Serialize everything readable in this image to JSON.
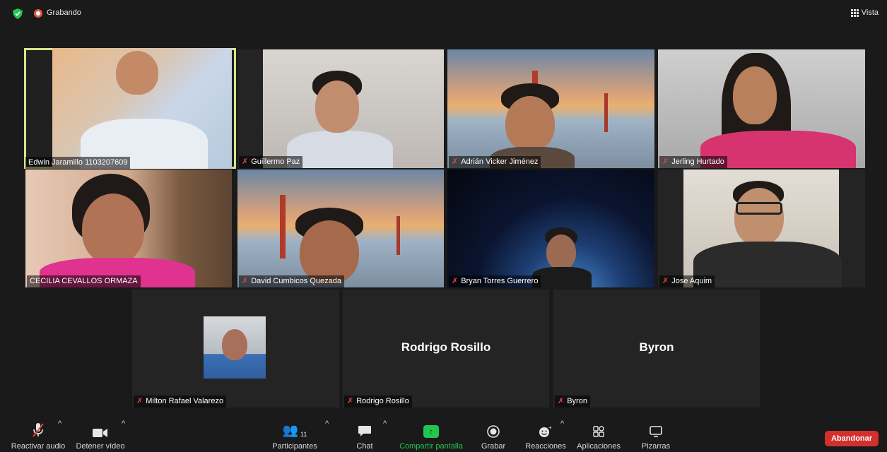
{
  "topbar": {
    "recording_label": "Grabando",
    "view_label": "Vista"
  },
  "tiles": [
    {
      "name": "Edwin Jaramillo 1103207609",
      "muted": false,
      "active": true
    },
    {
      "name": "Guillermo Paz",
      "muted": true
    },
    {
      "name": "Adrián Vicker Jiménez",
      "muted": true
    },
    {
      "name": "Jerling Hurtado",
      "muted": true
    },
    {
      "name": "CECILIA CEVALLOS ORMAZA",
      "muted": false
    },
    {
      "name": "David Cumbicos Quezada",
      "muted": true
    },
    {
      "name": "Bryan Torres Guerrero",
      "muted": true
    },
    {
      "name": "Jose Aquim",
      "muted": true
    },
    {
      "name": "Milton Rafael Valarezo",
      "muted": true
    },
    {
      "name": "Rodrigo Rosillo",
      "muted": true,
      "display_name": "Rodrigo Rosillo"
    },
    {
      "name": "Byron",
      "muted": true,
      "display_name": "Byron"
    }
  ],
  "toolbar": {
    "unmute": "Reactivar audio",
    "stop_video": "Detener vídeo",
    "participants": "Participantes",
    "participants_count": "11",
    "chat": "Chat",
    "share": "Compartir pantalla",
    "record": "Grabar",
    "reactions": "Reacciones",
    "apps": "Aplicaciones",
    "whiteboards": "Pizarras",
    "leave": "Abandonar"
  },
  "colors": {
    "background": "#1a1a1a",
    "active_speaker_border": "#d6e58a",
    "share_green": "#23c551",
    "leave_red": "#d32f2f",
    "muted_red": "#e0453a"
  }
}
